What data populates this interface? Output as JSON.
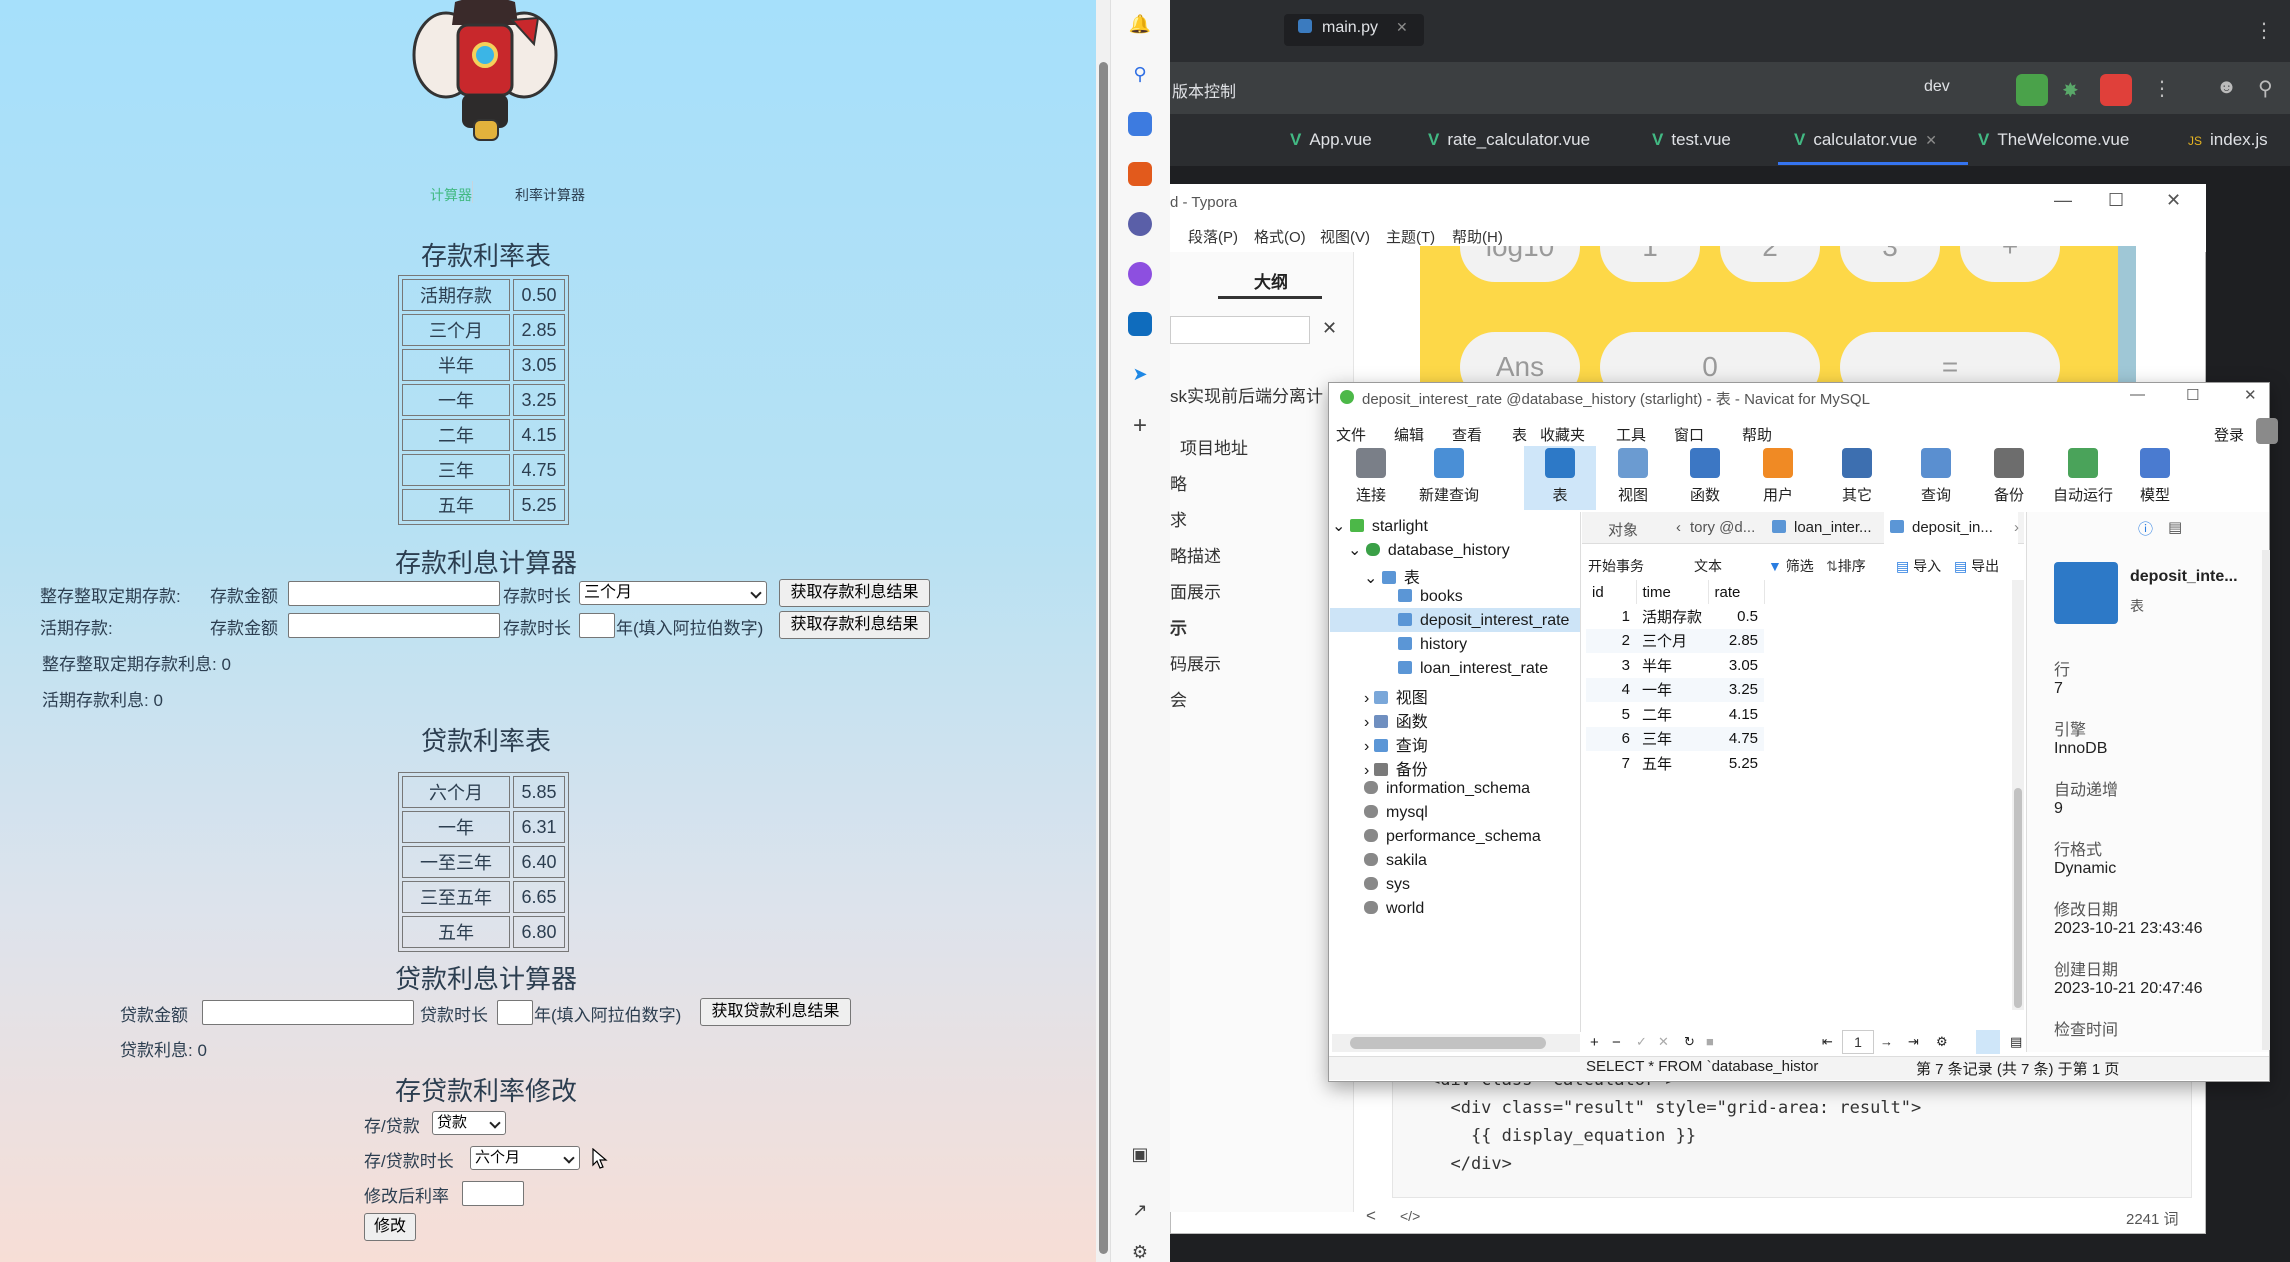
{
  "browser": {
    "nav": {
      "calculator": "计算器",
      "rate_calculator": "利率计算器"
    },
    "deposit_table": {
      "title": "存款利率表",
      "rows": [
        {
          "term": "活期存款",
          "rate": "0.50"
        },
        {
          "term": "三个月",
          "rate": "2.85"
        },
        {
          "term": "半年",
          "rate": "3.05"
        },
        {
          "term": "一年",
          "rate": "3.25"
        },
        {
          "term": "二年",
          "rate": "4.15"
        },
        {
          "term": "三年",
          "rate": "4.75"
        },
        {
          "term": "五年",
          "rate": "5.25"
        }
      ]
    },
    "deposit_calc": {
      "title": "存款利息计算器",
      "fixed_label": "整存整取定期存款:",
      "current_label": "活期存款:",
      "amount_label": "存款金额",
      "term_label": "存款时长",
      "term_selected": "三个月",
      "year_hint": "年(填入阿拉伯数字)",
      "button": "获取存款利息结果",
      "fixed_result": "整存整取定期存款利息: 0",
      "current_result": "活期存款利息: 0"
    },
    "loan_table": {
      "title": "贷款利率表",
      "rows": [
        {
          "term": "六个月",
          "rate": "5.85"
        },
        {
          "term": "一年",
          "rate": "6.31"
        },
        {
          "term": "一至三年",
          "rate": "6.40"
        },
        {
          "term": "三至五年",
          "rate": "6.65"
        },
        {
          "term": "五年",
          "rate": "6.80"
        }
      ]
    },
    "loan_calc": {
      "title": "贷款利息计算器",
      "amount_label": "贷款金额",
      "term_label": "贷款时长",
      "year_hint": "年(填入阿拉伯数字)",
      "button": "获取贷款利息结果",
      "result": "贷款利息: 0"
    },
    "modify": {
      "title": "存贷款利率修改",
      "type_label": "存/贷款",
      "type_selected": "贷款",
      "term_label": "存/贷款时长",
      "term_selected": "六个月",
      "rate_label": "修改后利率",
      "button": "修改"
    }
  },
  "ide": {
    "file_tab": "main.py",
    "vcs": "版本控制",
    "branch": "dev",
    "tabs": [
      "App.vue",
      "rate_calculator.vue",
      "test.vue",
      "calculator.vue",
      "TheWelcome.vue",
      "index.js"
    ],
    "active_tab": "calculator.vue"
  },
  "typora": {
    "title": "d - Typora",
    "menu": [
      "段落(P)",
      "格式(O)",
      "视图(V)",
      "主题(T)",
      "帮助(H)"
    ],
    "outline_tab": "大纲",
    "outline": [
      "sk实现前后端分离计",
      "项目地址",
      "略",
      "求",
      "略描述",
      "面展示",
      "示",
      "码展示",
      "会"
    ],
    "calc_keys": [
      "log10",
      "1",
      "2",
      "3",
      "+",
      "Ans",
      "0",
      "="
    ],
    "code_lines": [
      "<div class=\"calculator\">",
      "  <div class=\"result\" style=\"grid-area: result\">",
      "    {{ display_equation }}",
      "  </div>"
    ],
    "word_count": "2241 词"
  },
  "navicat": {
    "title": "deposit_interest_rate @database_history (starlight) - 表 - Navicat for MySQL",
    "menu": [
      "文件",
      "编辑",
      "查看",
      "表",
      "收藏夹",
      "工具",
      "窗口",
      "帮助"
    ],
    "login": "登录",
    "toolbar": [
      "连接",
      "新建查询",
      "表",
      "视图",
      "函数",
      "用户",
      "其它",
      "查询",
      "备份",
      "自动运行",
      "模型"
    ],
    "tree": {
      "connection": "starlight",
      "database": "database_history",
      "tables_node": "表",
      "tables": [
        "books",
        "deposit_interest_rate",
        "history",
        "loan_interest_rate"
      ],
      "groups": [
        "视图",
        "函数",
        "查询",
        "备份"
      ],
      "other_dbs": [
        "information_schema",
        "mysql",
        "performance_schema",
        "sakila",
        "sys",
        "world"
      ]
    },
    "tabs": [
      "对象",
      "tory @d...",
      "loan_inter...",
      "deposit_in..."
    ],
    "subtoolbar": [
      "开始事务",
      "文本",
      "筛选",
      "排序",
      "导入",
      "导出"
    ],
    "columns": [
      "id",
      "time",
      "rate"
    ],
    "rows": [
      [
        "1",
        "活期存款",
        "0.5"
      ],
      [
        "2",
        "三个月",
        "2.85"
      ],
      [
        "3",
        "半年",
        "3.05"
      ],
      [
        "4",
        "一年",
        "3.25"
      ],
      [
        "5",
        "二年",
        "4.15"
      ],
      [
        "6",
        "三年",
        "4.75"
      ],
      [
        "7",
        "五年",
        "5.25"
      ]
    ],
    "page": "1",
    "sql": "SELECT * FROM `database_histor",
    "record_status": "第 7 条记录 (共 7 条) 于第 1 页",
    "info": {
      "name": "deposit_inte...",
      "kind": "表",
      "rows_label": "行",
      "rows_value": "7",
      "engine_label": "引擎",
      "engine_value": "InnoDB",
      "auto_inc_label": "自动递增",
      "auto_inc_value": "9",
      "format_label": "行格式",
      "format_value": "Dynamic",
      "modified_label": "修改日期",
      "modified_value": "2023-10-21 23:43:46",
      "created_label": "创建日期",
      "created_value": "2023-10-21 20:47:46",
      "check_label": "检查时间"
    }
  }
}
